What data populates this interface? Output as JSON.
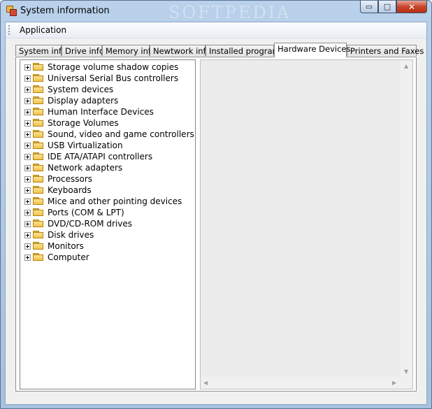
{
  "window": {
    "title": "System information",
    "watermark": "SOFTPEDIA",
    "controls": {
      "minimize": "▭",
      "maximize": "□",
      "close": "✕"
    }
  },
  "menu": {
    "items": [
      "Application"
    ]
  },
  "tabs": [
    {
      "label": "System info",
      "active": false
    },
    {
      "label": "Drive info",
      "active": false
    },
    {
      "label": "Memory info",
      "active": false
    },
    {
      "label": "Newtwork info",
      "active": false
    },
    {
      "label": "Installed programs",
      "active": false
    },
    {
      "label": "Hardware Devices",
      "active": true
    },
    {
      "label": "Printers and Faxes",
      "active": false
    }
  ],
  "tree": {
    "items": [
      "Storage volume shadow copies",
      "Universal Serial Bus controllers",
      "System devices",
      "Display adapters",
      "Human Interface Devices",
      "Storage Volumes",
      "Sound, video and game controllers",
      "USB Virtualization",
      "IDE ATA/ATAPI controllers",
      "Network adapters",
      "Processors",
      "Keyboards",
      "Mice and other pointing devices",
      "Ports (COM & LPT)",
      "DVD/CD-ROM drives",
      "Disk drives",
      "Monitors",
      "Computer"
    ]
  },
  "icons": {
    "expand": "plus-box-icon",
    "node": "folder-icon",
    "scroll_up": "▲",
    "scroll_down": "▼",
    "scroll_left": "◀",
    "scroll_right": "▶"
  }
}
